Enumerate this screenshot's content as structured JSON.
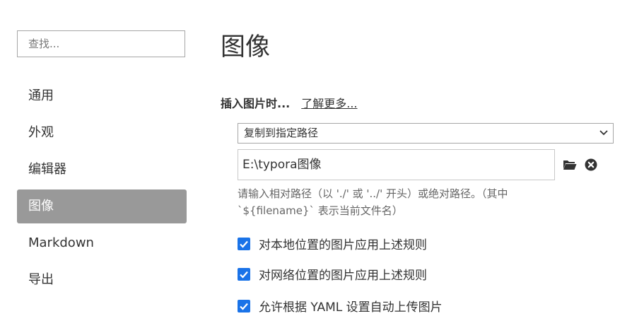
{
  "search": {
    "placeholder": "查找..."
  },
  "sidebar": {
    "items": [
      {
        "label": "通用"
      },
      {
        "label": "外观"
      },
      {
        "label": "编辑器"
      },
      {
        "label": "图像"
      },
      {
        "label": "Markdown"
      },
      {
        "label": "导出"
      }
    ]
  },
  "main": {
    "title": "图像",
    "insert_image_label": "插入图片时...",
    "learn_more": "了解更多...",
    "action_select": {
      "value": "复制到指定路径"
    },
    "path_input": {
      "value": "E:\\typora图像"
    },
    "hint_line1": "请输入相对路径（以 './' 或 '../' 开头）或绝对路径。（其中",
    "hint_line2": "`${filename}` 表示当前文件名）",
    "checkboxes": [
      {
        "label": "对本地位置的图片应用上述规则",
        "checked": true
      },
      {
        "label": "对网络位置的图片应用上述规则",
        "checked": true
      },
      {
        "label": "允许根据 YAML 设置自动上传图片",
        "checked": true
      }
    ]
  },
  "colors": {
    "active_nav_bg": "#999999",
    "checkbox_accent": "#1a73e8",
    "text": "#333333"
  }
}
